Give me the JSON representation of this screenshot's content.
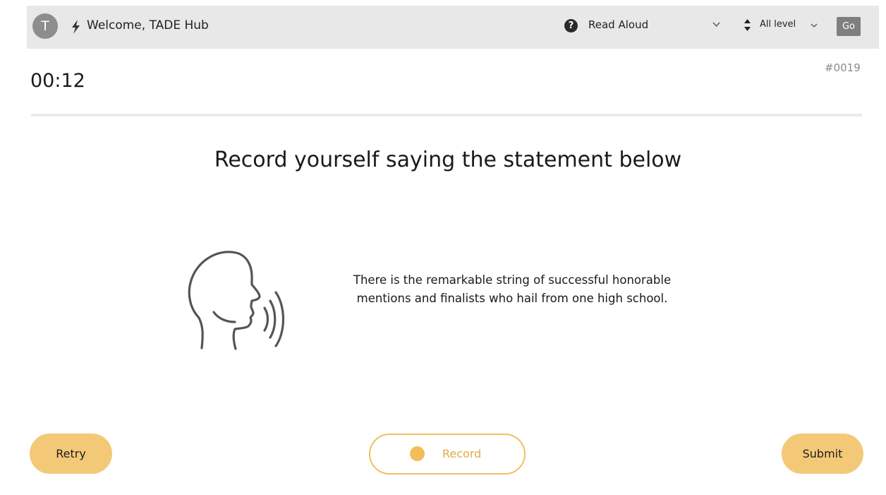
{
  "header": {
    "avatar_initial": "T",
    "welcome_text": "Welcome, TADE Hub",
    "task_type": "Read Aloud",
    "level": "All level",
    "go_label": "Go"
  },
  "timer": "00:12",
  "question_id": "#0019",
  "instruction": "Record yourself saying the statement below",
  "statement_lines": [
    "There is the remarkable string of successful honorable",
    "mentions and finalists who hail from one high school."
  ],
  "actions": {
    "retry_label": "Retry",
    "record_label": "Record",
    "submit_label": "Submit"
  },
  "colors": {
    "accent": "#f3c978",
    "record_accent": "#f1bf60",
    "topbar": "#e8e8e8"
  },
  "icons": {
    "bolt": "bolt-icon",
    "help": "question-circle-icon",
    "task_chevron": "chevron-down-icon",
    "sort": "sort-arrows-icon",
    "level_chevron": "chevron-down-icon",
    "speaker": "speaking-head-icon",
    "record": "record-dot-icon"
  }
}
